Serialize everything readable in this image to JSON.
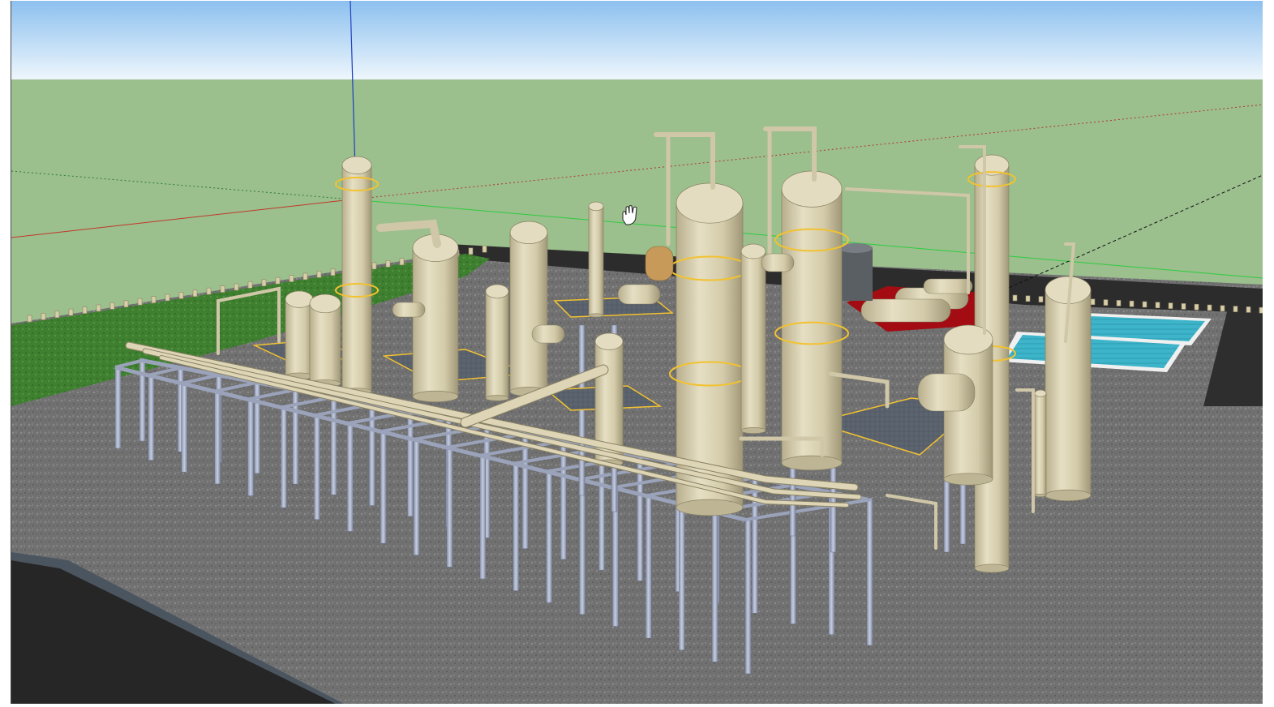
{
  "scene": {
    "colors": {
      "sky_top": "#8fc1f0",
      "sky_bottom": "#e8f3fb",
      "grass": "#9cc08d",
      "ground_gravel": "#6e6e6e",
      "road": "#2b2b2b",
      "vessel": "#d7cfae",
      "vessel_shade": "#a79f80",
      "steel": "#a9b2c8",
      "handrail": "#f2c230",
      "red_pad": "#a30c12",
      "pool_water": "#3fb2c8",
      "red_axis": "#c0392b",
      "green_axis": "#2ecc40",
      "blue_axis": "#1f3fbf"
    },
    "icons": {
      "cursor": "hand-pan-cursor"
    }
  }
}
